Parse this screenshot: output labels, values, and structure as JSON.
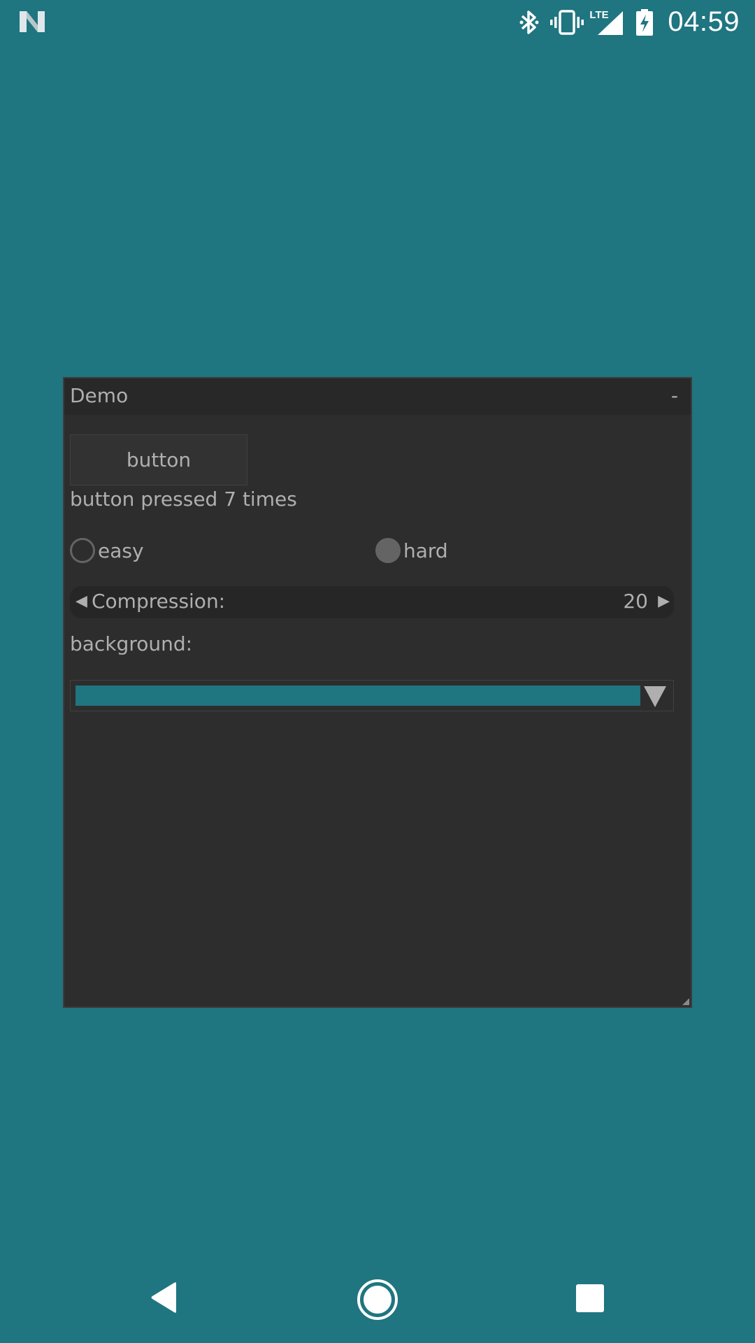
{
  "status_bar": {
    "time": "04:59",
    "network_label": "LTE",
    "icons": [
      "n-logo-icon",
      "bluetooth-icon",
      "vibrate-icon",
      "lte-signal-icon",
      "battery-charging-icon"
    ]
  },
  "window": {
    "title": "Demo",
    "minimize_label": "-",
    "button_label": "button",
    "pressed_text": "button pressed 7 times",
    "radios": [
      {
        "label": "easy",
        "selected": false
      },
      {
        "label": "hard",
        "selected": true
      }
    ],
    "compression": {
      "label": "Compression:",
      "value": "20",
      "left_arrow": "◀",
      "right_arrow": "▶"
    },
    "background_label": "background:",
    "background_color": "#1f7580"
  },
  "colors": {
    "desktop": "#1f7580",
    "window_bg": "#2d2d2d",
    "titlebar_bg": "#282828",
    "text": "#afafaf",
    "widget_border": "#414141"
  },
  "nav_bar": {
    "buttons": [
      "back-icon",
      "home-icon",
      "recents-icon"
    ]
  }
}
